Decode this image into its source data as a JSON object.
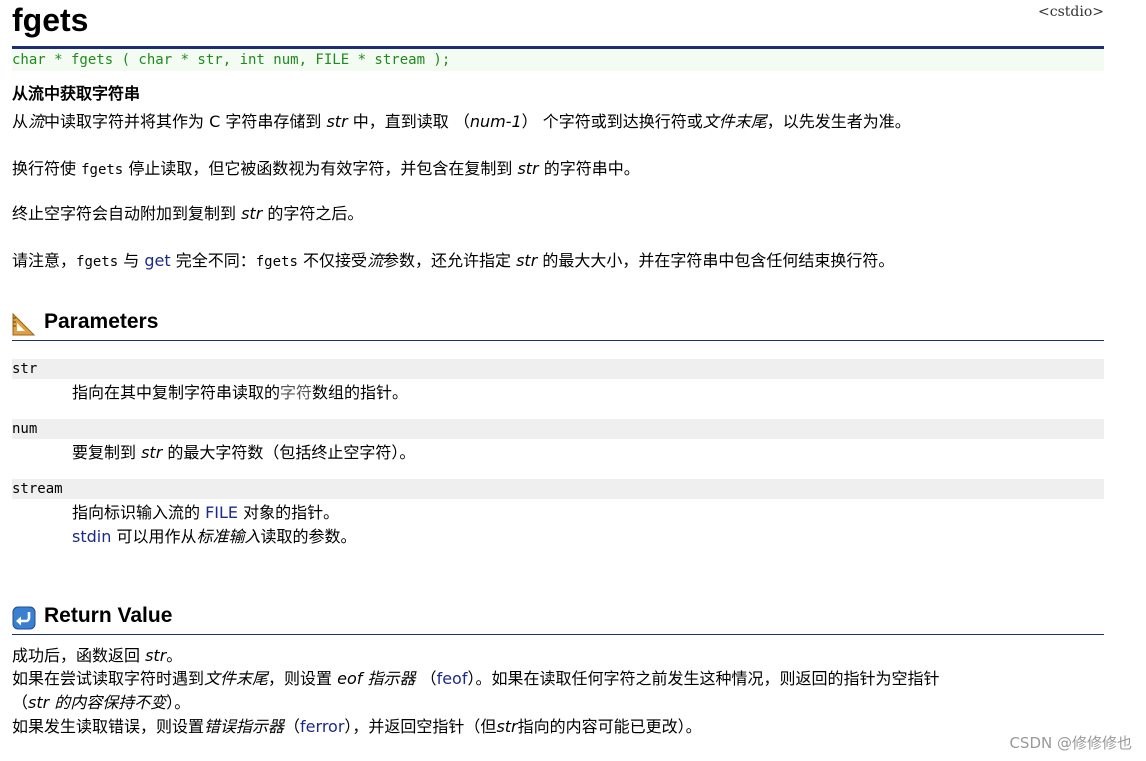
{
  "header": {
    "title": "fgets",
    "ref": "<cstdio>",
    "prototype": "char * fgets ( char * str, int num, FILE * stream );"
  },
  "summary": "从流中获取字符串",
  "description": {
    "p1": [
      "从",
      "流",
      "中读取字符并将其作为 C 字符串存储到 ",
      "str",
      " 中，直到读取 （",
      "num-1",
      "） 个字符或到达换行符或",
      "文件末尾",
      "，以先发生者为准。"
    ],
    "p2": [
      "换行符使 ",
      "fgets",
      " 停止读取，但它被函数视为有效字符，并包含在复制到 ",
      "str",
      " 的字符串中。"
    ],
    "p3": [
      "终止空字符会自动附加到复制到 ",
      "str",
      " 的字符之后。"
    ],
    "p4": [
      "请注意，",
      "fgets",
      " 与 ",
      "get",
      " 完全不同：",
      "fgets",
      " 不仅接受",
      "流",
      "参数，还允许指定 ",
      "str",
      " 的最大大小，并在字符串中包含任何结束换行符。"
    ]
  },
  "parameters": {
    "heading": "Parameters",
    "items": [
      {
        "name": "str",
        "desc": [
          "指向在其中复制字符串读取的",
          "字符",
          "数组的指针。"
        ]
      },
      {
        "name": "num",
        "desc": [
          "要复制到 ",
          "str",
          " 的最大字符数（包括终止空字符）。"
        ]
      },
      {
        "name": "stream",
        "desc": [
          "指向标识输入流的 ",
          "FILE",
          " 对象的指针。"
        ],
        "desc2": [
          "stdin",
          " 可以用作从",
          "标准输入",
          "读取的参数。"
        ]
      }
    ]
  },
  "return_value": {
    "heading": "Return Value",
    "l1": [
      "成功后，函数返回 ",
      "str",
      "。"
    ],
    "l2": [
      "如果在尝试读取字符时遇到",
      "文件末尾",
      "，则设置 ",
      "eof 指示器",
      " （",
      "feof",
      "）。如果在读取任何字符之前发生这种情况，则返回的指针为空指针"
    ],
    "l3": [
      "（",
      "str 的内容保持不变",
      "）。"
    ],
    "l4": [
      "如果发生读取错误，则设置",
      "错误指示器",
      "（",
      "ferror",
      "），并返回空指针（但",
      "str",
      "指向的内容可能已更改）。"
    ]
  },
  "watermark": "CSDN @修修修也",
  "colors": {
    "rule": "#1f2f6e",
    "prototype_text": "#1f8a1f",
    "link": "#1a2a8a",
    "param_bg": "#efefef"
  },
  "icons": {
    "parameters": "ruler-triangle-icon",
    "return": "return-arrow-icon"
  }
}
